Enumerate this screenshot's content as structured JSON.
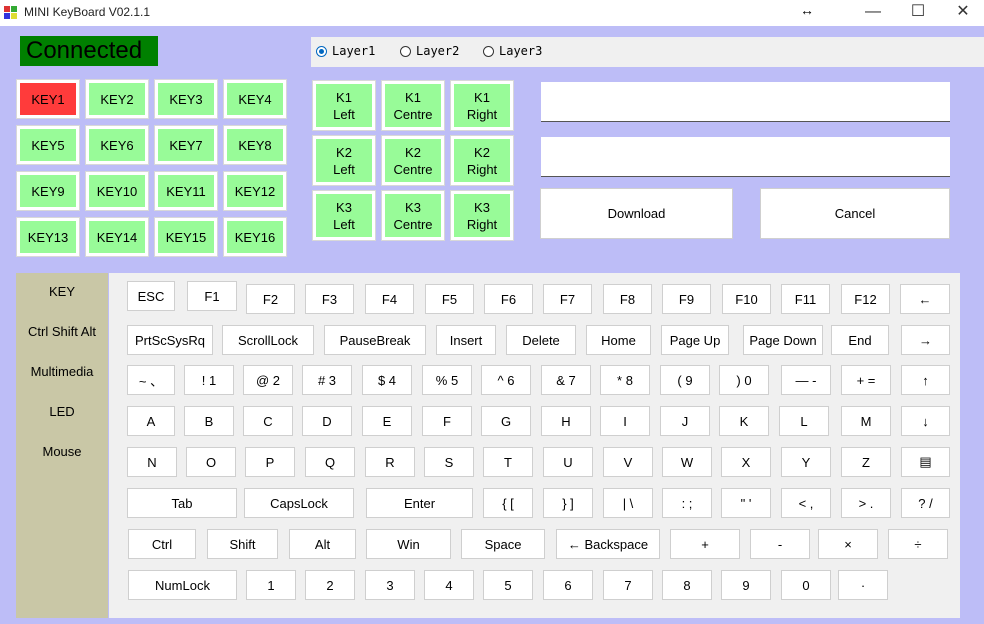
{
  "window": {
    "title": "MINI KeyBoard V02.1.1",
    "resize_glyph": "↔",
    "minimize": "—",
    "maximize": "☐",
    "close": "✕"
  },
  "status": {
    "text": "Connected",
    "color": "#008000"
  },
  "layers": {
    "items": [
      "Layer1",
      "Layer2",
      "Layer3"
    ],
    "selected": 0
  },
  "keys": [
    "KEY1",
    "KEY2",
    "KEY3",
    "KEY4",
    "KEY5",
    "KEY6",
    "KEY7",
    "KEY8",
    "KEY9",
    "KEY10",
    "KEY11",
    "KEY12",
    "KEY13",
    "KEY14",
    "KEY15",
    "KEY16"
  ],
  "selected_key": 0,
  "knobs": [
    [
      "K1 Left",
      "K1 Centre",
      "K1 Right"
    ],
    [
      "K2 Left",
      "K2 Centre",
      "K2 Right"
    ],
    [
      "K3 Left",
      "K3 Centre",
      "K3 Right"
    ]
  ],
  "fields": {
    "field1": "",
    "field2": ""
  },
  "buttons": {
    "download": "Download",
    "cancel": "Cancel"
  },
  "tabs": [
    "KEY",
    "Ctrl Shift Alt",
    "Multimedia",
    "LED",
    "Mouse"
  ],
  "keyboard": [
    [
      "ESC",
      "F1",
      "F2",
      "F3",
      "F4",
      "F5",
      "F6",
      "F7",
      "F8",
      "F9",
      "F10",
      "F11",
      "F12",
      "←"
    ],
    [
      "PrtScSysRq",
      "ScrollLock",
      "PauseBreak",
      "Insert",
      "Delete",
      "Home",
      "Page Up",
      "Page Down",
      "End",
      "→"
    ],
    [
      "~ 、",
      "! 1",
      "@ 2",
      "# 3",
      "$ 4",
      "% 5",
      "^ 6",
      "& 7",
      "* 8",
      "( 9",
      ") 0",
      "— -",
      "+ =",
      "↑"
    ],
    [
      "A",
      "B",
      "C",
      "D",
      "E",
      "F",
      "G",
      "H",
      "I",
      "J",
      "K",
      "L",
      "M",
      "↓"
    ],
    [
      "N",
      "O",
      "P",
      "Q",
      "R",
      "S",
      "T",
      "U",
      "V",
      "W",
      "X",
      "Y",
      "Z",
      "▤"
    ],
    [
      "Tab",
      "CapsLock",
      "Enter",
      "{ [",
      "} ]",
      "| \\",
      ": ;",
      "\" '",
      "< ,",
      "> .",
      "? /"
    ],
    [
      "Ctrl",
      "Shift",
      "Alt",
      "Win",
      "Space",
      "← Backspace",
      "+",
      "-",
      "×",
      "÷"
    ],
    [
      "NumLock",
      "1",
      "2",
      "3",
      "4",
      "5",
      "6",
      "7",
      "8",
      "9",
      "0",
      "·"
    ]
  ],
  "colors": {
    "background": "#bdbdf7",
    "key_green": "#98fb98",
    "key_selected": "#ff3b3b",
    "tab_panel": "#c9c7a6"
  }
}
